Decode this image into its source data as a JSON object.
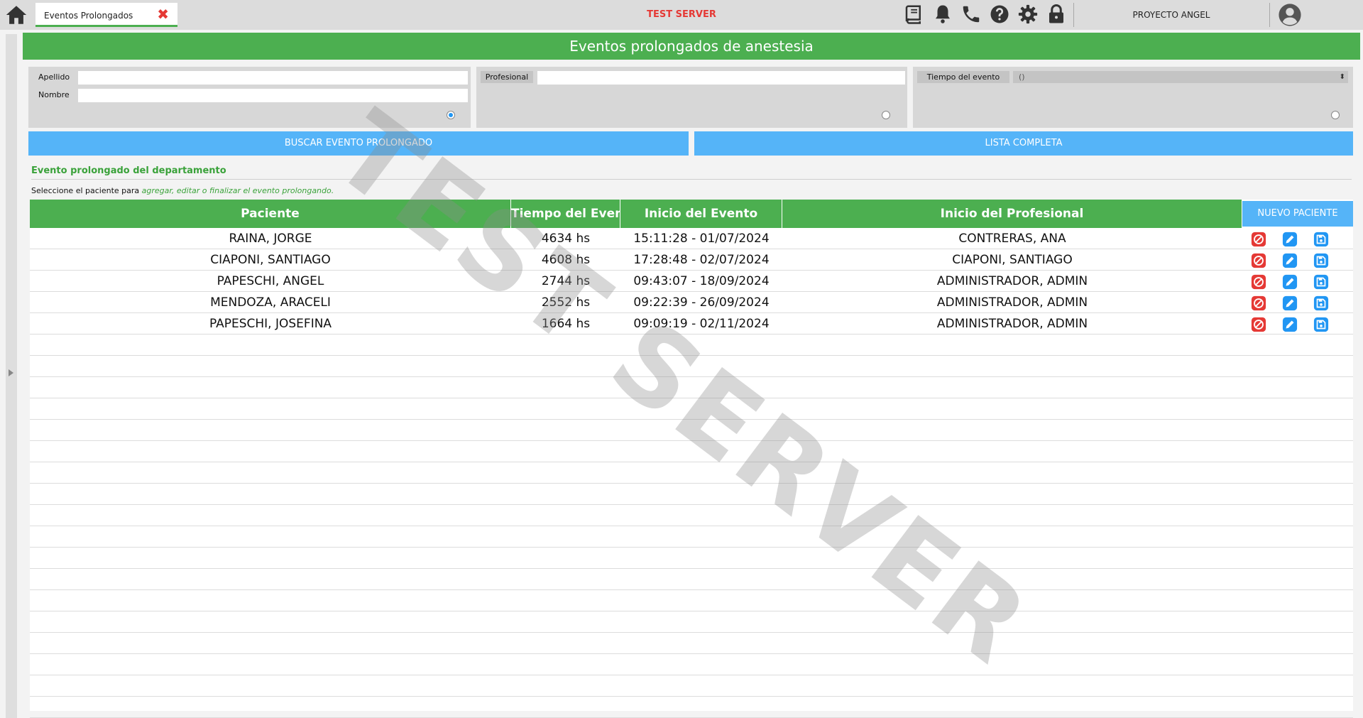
{
  "tab": {
    "label": "Eventos Prolongados"
  },
  "header": {
    "server_label": "TEST SERVER",
    "project_label": "PROYECTO ANGEL"
  },
  "page": {
    "title": "Eventos prolongados de anestesia"
  },
  "filters": {
    "apellido_label": "Apellido",
    "apellido_value": "",
    "nombre_label": "Nombre",
    "nombre_value": "",
    "profesional_label": "Profesional",
    "profesional_value": "",
    "tiempo_label": "Tiempo del evento",
    "tiempo_value": "()"
  },
  "buttons": {
    "buscar": "BUSCAR EVENTO PROLONGADO",
    "lista": "LISTA COMPLETA",
    "nuevo": "NUEVO PACIENTE"
  },
  "section": {
    "title": "Evento prolongado del departamento",
    "instruction_prefix": "Seleccione el paciente para",
    "instruction_highlight": "agregar, editar o finalizar el evento prolongando."
  },
  "table": {
    "headers": [
      "Paciente",
      "Tiempo del Evento",
      "Inicio del Evento",
      "Inicio del Profesional"
    ],
    "rows": [
      [
        "RAINA, JORGE",
        "4634 hs",
        "15:11:28 - 01/07/2024",
        "CONTRERAS, ANA"
      ],
      [
        "CIAPONI, SANTIAGO",
        "4608 hs",
        "17:28:48 - 02/07/2024",
        "CIAPONI, SANTIAGO"
      ],
      [
        "PAPESCHI, ANGEL",
        "2744 hs",
        "09:43:07 - 18/09/2024",
        "ADMINISTRADOR, ADMIN"
      ],
      [
        "MENDOZA, ARACELI",
        "2552 hs",
        "09:22:39 - 26/09/2024",
        "ADMINISTRADOR, ADMIN"
      ],
      [
        "PAPESCHI, JOSEFINA",
        "1664 hs",
        "09:09:19 - 02/11/2024",
        "ADMINISTRADOR, ADMIN"
      ]
    ]
  },
  "watermark": "TEST SERVER",
  "colors": {
    "green": "#4caf50",
    "blue": "#55b4f8",
    "red": "#e53935",
    "icon_blue": "#2196f3"
  },
  "icons": [
    "home-icon",
    "close-icon",
    "book-icon",
    "bell-icon",
    "phone-icon",
    "help-icon",
    "gear-icon",
    "lock-icon",
    "user-avatar-icon",
    "cancel-icon",
    "edit-icon",
    "save-icon"
  ]
}
